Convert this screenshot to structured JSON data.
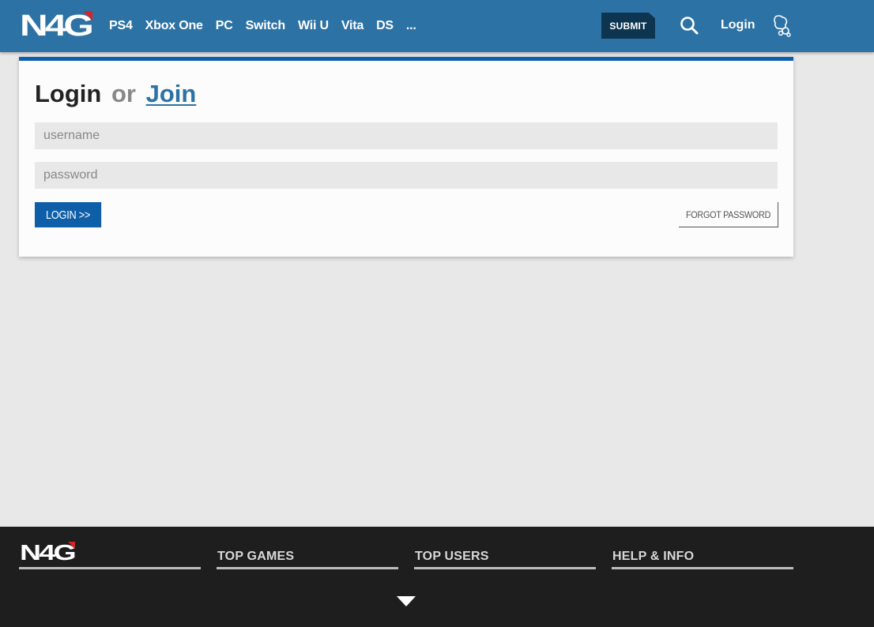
{
  "header": {
    "logo_text": "N4G",
    "nav_items": [
      "PS4",
      "Xbox One",
      "PC",
      "Switch",
      "Wii U",
      "Vita",
      "DS",
      "..."
    ],
    "submit_label": "SUBMIT",
    "login_label": "Login",
    "search_icon": "search-icon",
    "notification_icon": "chat-bubbles-icon"
  },
  "login_card": {
    "title_login": "Login",
    "title_or": "or",
    "title_join": "Join",
    "username_placeholder": "username",
    "password_placeholder": "password",
    "login_button": "LOGIN >>",
    "forgot_button": "FORGOT PASSWORD"
  },
  "footer": {
    "logo_text": "N4G",
    "columns": [
      "TOP GAMES",
      "TOP USERS",
      "HELP & INFO"
    ],
    "expand_icon": "triangle-down-icon"
  },
  "colors": {
    "header_bg": "#2d72a5",
    "accent_blue": "#0e5fa8",
    "logo_red": "#d8232a",
    "footer_bg": "#1e1e1e"
  }
}
